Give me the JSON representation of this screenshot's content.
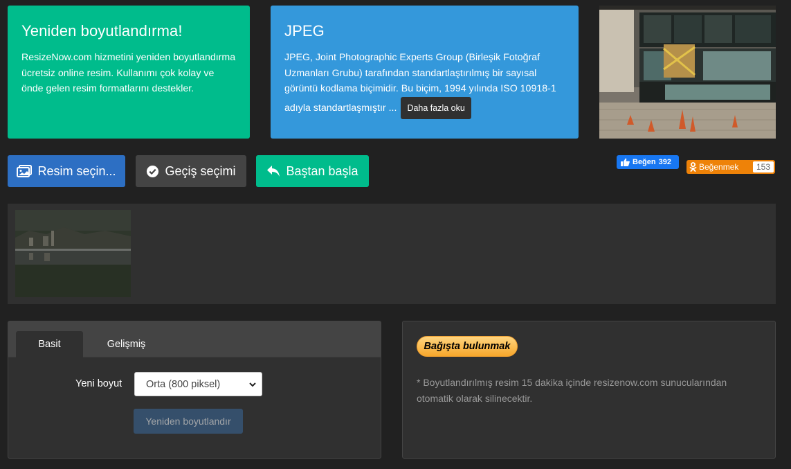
{
  "intro_card": {
    "title": "Yeniden boyutlandırma!",
    "text": "ResizeNow.com hizmetini yeniden boyutlandırma ücretsiz online resim. Kullanımı çok kolay ve önde gelen resim formatlarını destekler."
  },
  "format_card": {
    "title": "JPEG",
    "text": "JPEG, Joint Photographic Experts Group (Birleşik Fotoğraf Uzmanları Grubu) tarafından standartlaştırılmış bir sayısal görüntü kodlama biçimidir. Bu biçim, 1994 yılında ISO 10918-1 adıyla standartlaşmıştır ...",
    "read_more": "Daha fazla oku"
  },
  "actions": {
    "select_image": "Resim seçin...",
    "transition": "Geçiş seçimi",
    "restart": "Baştan başla"
  },
  "social": {
    "fb_label": "Beğen",
    "fb_count": "392",
    "ok_label": "Beğenmek",
    "ok_count": "153"
  },
  "settings": {
    "tabs": [
      "Basit",
      "Gelişmiş"
    ],
    "size_label": "Yeni boyut",
    "size_value": "Orta (800 piksel)",
    "resize_button": "Yeniden boyutlandır"
  },
  "info": {
    "donate": "Bağışta bulunmak",
    "note": "* Boyutlandırılmış resim 15 dakika içinde resizenow.com sunucularından otomatik olarak silinecektir."
  },
  "colors": {
    "background": "#212121",
    "green": "#00bc8c",
    "blue": "#3498db",
    "panel": "#303030"
  }
}
